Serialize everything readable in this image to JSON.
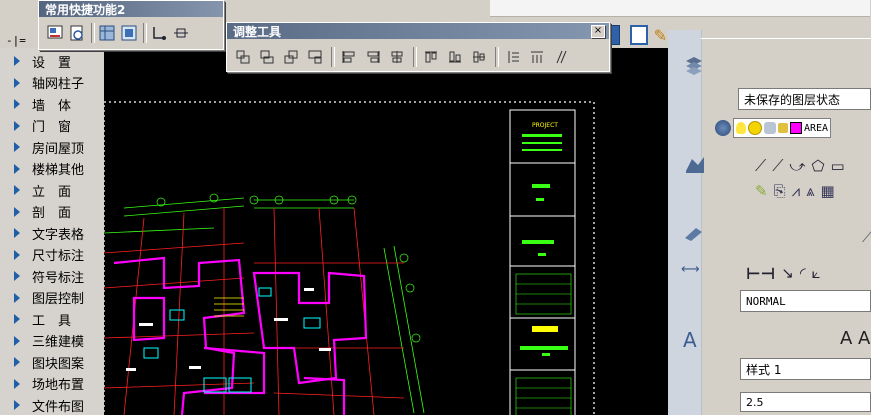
{
  "toolbar_common": {
    "title": "常用快捷功能2"
  },
  "toolbar_adjust": {
    "title": "调整工具",
    "close": "×"
  },
  "sidebar": {
    "items": [
      {
        "label": "设　置"
      },
      {
        "label": "轴网柱子"
      },
      {
        "label": "墙　体"
      },
      {
        "label": "门　窗"
      },
      {
        "label": "房间屋顶"
      },
      {
        "label": "楼梯其他"
      },
      {
        "label": "立　面"
      },
      {
        "label": "剖　面"
      },
      {
        "label": "文字表格"
      },
      {
        "label": "尺寸标注"
      },
      {
        "label": "符号标注"
      },
      {
        "label": "图层控制"
      },
      {
        "label": "工　具"
      },
      {
        "label": "三维建模"
      },
      {
        "label": "图块图案"
      },
      {
        "label": "场地布置"
      },
      {
        "label": "文件布图"
      }
    ]
  },
  "right_panel": {
    "layer_state": "未保存的图层状态",
    "layer_name": "AREA",
    "dim_style": "NORMAL",
    "text_style": "样式 1",
    "text_height": "2.5",
    "text_big_letters": "A A"
  },
  "drawing": {
    "project_stamp": "PROJECT"
  },
  "colors": {
    "canvas": "#000000",
    "accent_title": "#5d6e88",
    "cad_green": "#39ff14",
    "cad_magenta": "#ff00ff",
    "cad_red": "#ff2020",
    "cad_yellow": "#ffff00",
    "cad_cyan": "#00ffff"
  }
}
